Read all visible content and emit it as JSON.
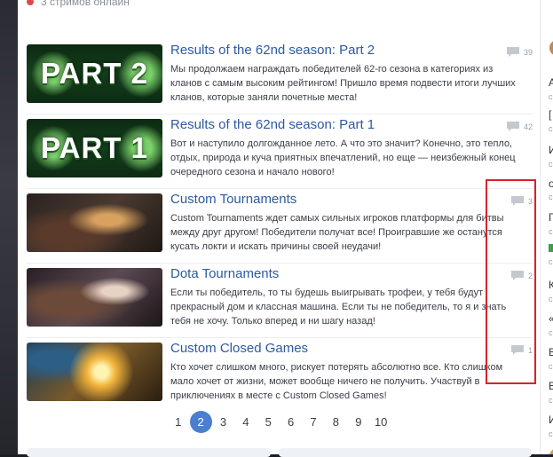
{
  "header": {
    "streams_online": "3 стримов онлайн"
  },
  "news": [
    {
      "title": "Results of the 62nd season: Part 2",
      "description": "Мы продолжаем награждать победителей 62-го сезона в категориях из кланов с самым высоким рейтингом! Пришло время подвести итоги лучших кланов, которые заняли почетные места!",
      "comments": "39",
      "thumb_text": "PART 2"
    },
    {
      "title": "Results of the 62nd season: Part 1",
      "description": "Вот и наступило долгожданное лето. А что это значит? Конечно, это тепло, отдых, природа и куча приятных впечатлений, но еще — неизбежный конец очередного сезона и начало нового!",
      "comments": "42",
      "thumb_text": "PART 1"
    },
    {
      "title": "Custom Tournaments",
      "description": "Custom Tournaments ждет самых сильных игроков платформы для битвы между друг другом! Победители получат все! Проигравшие же останутся кусать локти и искать причины своей неудачи!",
      "comments": "3",
      "thumb_text": ""
    },
    {
      "title": "Dota Tournaments",
      "description": "Если ты победитель, то ты будешь выигрывать трофеи, у тебя будут прекрасный дом и классная машина. Если ты не победитель, то я и знать тебя не хочу. Только вперед и ни шагу назад!",
      "comments": "2",
      "thumb_text": ""
    },
    {
      "title": "Custom Closed Games",
      "description": "Кто хочет слишком много, рискует потерять абсолютно все. Кто слишком мало хочет от жизни, может вообще ничего не получить. Участвуй в приключениях в месте с Custom Closed Games!",
      "comments": "1",
      "thumb_text": ""
    }
  ],
  "pagination": {
    "pages": [
      "1",
      "2",
      "3",
      "4",
      "5",
      "6",
      "7",
      "8",
      "9",
      "10"
    ],
    "active": "2"
  },
  "right_panel": {
    "items": [
      "A",
      "[",
      "И",
      "о",
      "Г",
      "",
      "К",
      "«",
      "В",
      "В",
      "И"
    ],
    "subs": [
      "с",
      "с",
      "с",
      "с",
      "с",
      "с",
      "с",
      "с",
      "с",
      "с",
      "с"
    ]
  },
  "colors": {
    "accent": "#4a7fd0",
    "title": "#2c5aa0",
    "live": "#e04848",
    "highlight": "#d8232a"
  }
}
